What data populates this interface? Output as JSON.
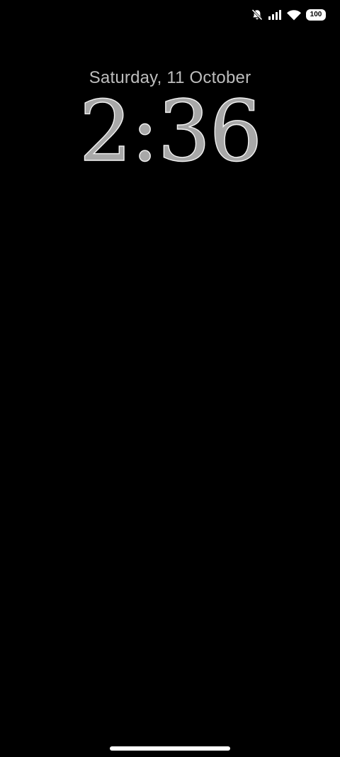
{
  "status_bar": {
    "icons": [
      "bell-muted-icon",
      "cellular-signal-icon",
      "wifi-icon",
      "battery-icon"
    ],
    "battery_level": "100"
  },
  "lock_screen": {
    "date": "Saturday, 11 October",
    "time": "2:36"
  },
  "colors": {
    "background": "#000000",
    "date_text": "#bdbdbd",
    "clock_fill": "#a8a8a8",
    "clock_outline": "#f2f2f2"
  }
}
